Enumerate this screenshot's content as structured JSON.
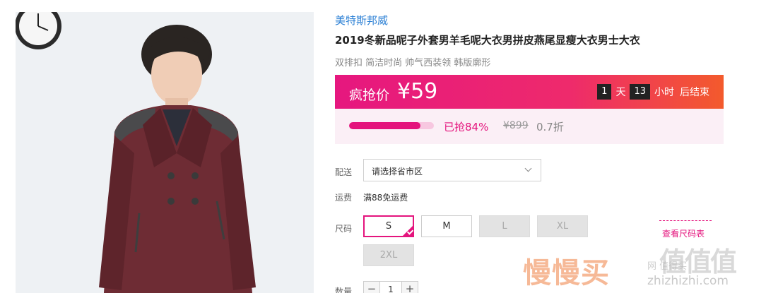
{
  "product": {
    "brand": "美特斯邦威",
    "title": "2019冬新品呢子外套男羊毛呢大衣男拼皮燕尾显瘦大衣男士大衣",
    "subtitle": "双排扣 简洁时尚 帅气西装领 韩版廓形"
  },
  "promo": {
    "label": "疯抢价",
    "price": "¥59",
    "countdown": {
      "days": "1",
      "days_unit": "天",
      "hours": "13",
      "hours_unit": "小时",
      "suffix": "后结束"
    },
    "progress_fraction": 0.84,
    "sold_text": "已抢84%",
    "original_price": "¥899",
    "discount": "0.7折"
  },
  "delivery": {
    "label": "配送",
    "placeholder_value": "请选择省市区"
  },
  "shipping": {
    "label": "运费",
    "value": "满88免运费"
  },
  "size": {
    "label": "尺码",
    "options": [
      {
        "label": "S",
        "state": "selected"
      },
      {
        "label": "M",
        "state": "available"
      },
      {
        "label": "L",
        "state": "disabled"
      },
      {
        "label": "XL",
        "state": "disabled"
      },
      {
        "label": "2XL",
        "state": "disabled"
      }
    ],
    "chart_link": "查看尺码表"
  },
  "quantity": {
    "label": "数量",
    "minus": "−",
    "value": "1",
    "plus": "+"
  },
  "watermark": {
    "logo_text": "慢慢买",
    "site_text": "值值值",
    "site_sub": "网 值得买",
    "url": "zhizhizhi.com"
  },
  "colors": {
    "accent": "#e4147d",
    "brand_link": "#2a7fd4"
  }
}
